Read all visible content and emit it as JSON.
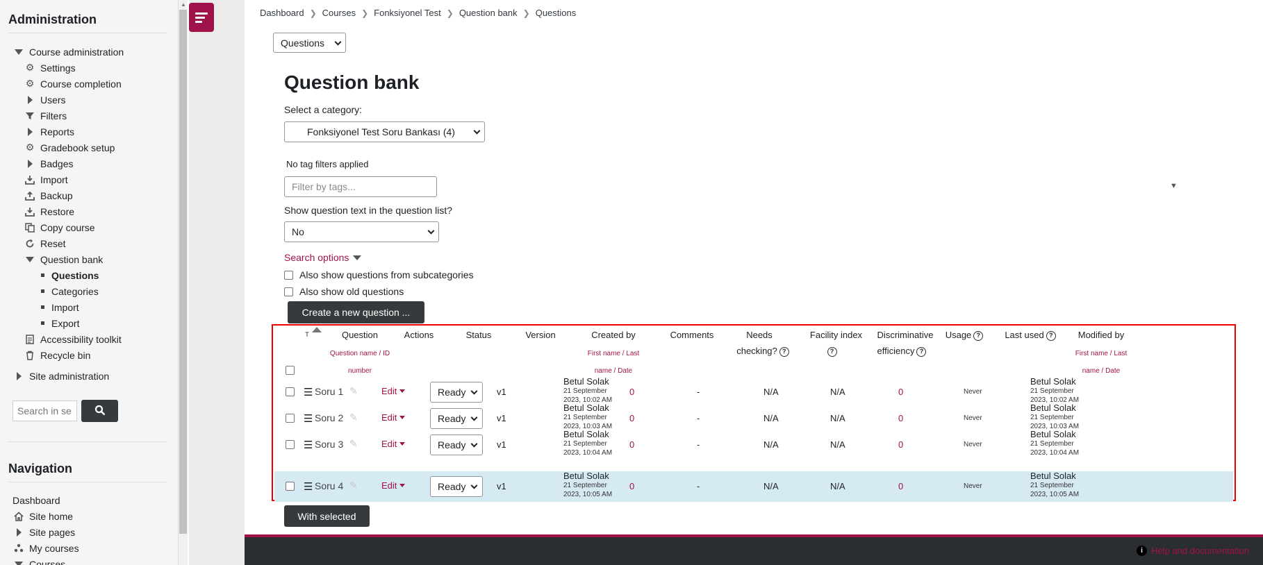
{
  "sidebar": {
    "admin_title": "Administration",
    "items": [
      {
        "label": "Course administration",
        "icon": "triangle-down"
      },
      {
        "label": "Settings",
        "icon": "gear-icon"
      },
      {
        "label": "Course completion",
        "icon": "gear-icon"
      },
      {
        "label": "Users",
        "icon": "triangle-right"
      },
      {
        "label": "Filters",
        "icon": "filter-icon"
      },
      {
        "label": "Reports",
        "icon": "triangle-right"
      },
      {
        "label": "Gradebook setup",
        "icon": "gear-icon"
      },
      {
        "label": "Badges",
        "icon": "triangle-right"
      },
      {
        "label": "Import",
        "icon": "import-icon"
      },
      {
        "label": "Backup",
        "icon": "backup-icon"
      },
      {
        "label": "Restore",
        "icon": "restore-icon"
      },
      {
        "label": "Copy course",
        "icon": "copy-icon"
      },
      {
        "label": "Reset",
        "icon": "reset-icon"
      },
      {
        "label": "Question bank",
        "icon": "triangle-down"
      },
      {
        "label": "Questions",
        "icon": "bullet"
      },
      {
        "label": "Categories",
        "icon": "bullet"
      },
      {
        "label": "Import",
        "icon": "bullet"
      },
      {
        "label": "Export",
        "icon": "bullet"
      },
      {
        "label": "Accessibility toolkit",
        "icon": "toolkit-icon"
      },
      {
        "label": "Recycle bin",
        "icon": "trash-icon"
      },
      {
        "label": "Site administration",
        "icon": "triangle-right"
      }
    ],
    "search_placeholder": "Search in se",
    "nav_title": "Navigation",
    "nav_items": [
      {
        "label": "Dashboard"
      },
      {
        "label": "Site home",
        "icon": "home-icon"
      },
      {
        "label": "Site pages",
        "icon": "triangle-right"
      },
      {
        "label": "My courses",
        "icon": "courses-icon"
      },
      {
        "label": "Courses",
        "icon": "triangle-down"
      }
    ]
  },
  "breadcrumb": [
    "Dashboard",
    "Courses",
    "Fonksiyonel Test",
    "Question bank",
    "Questions"
  ],
  "page_select": "Questions",
  "page_title": "Question bank",
  "category_label": "Select a category:",
  "category_value": "Fonksiyonel Test Soru Bankası (4)",
  "tag_status": "No tag filters applied",
  "tag_placeholder": "Filter by tags...",
  "show_text_label": "Show question text in the question list?",
  "show_text_value": "No",
  "search_options": "Search options",
  "opt_subcategories": "Also show questions from subcategories",
  "opt_old": "Also show old questions",
  "create_button": "Create a new question ...",
  "table": {
    "col_t": "T",
    "col_question": "Question",
    "col_question_sub": "Question name / ID",
    "col_question_sub2": "number",
    "col_actions": "Actions",
    "col_status": "Status",
    "col_version": "Version",
    "col_created": "Created by",
    "col_created_sub": "First name / Last",
    "col_created_sub2": "name / Date",
    "col_comments": "Comments",
    "col_needs": "Needs",
    "col_needs2": "checking?",
    "col_facility": "Facility index",
    "col_discrim": "Discriminative",
    "col_discrim2": "efficiency",
    "col_usage": "Usage",
    "col_lastused": "Last used",
    "col_modified": "Modified by",
    "col_modified_sub": "First name / Last",
    "col_modified_sub2": "name / Date",
    "rows": [
      {
        "name": "Soru 1",
        "edit": "Edit",
        "status": "Ready",
        "version": "v1",
        "creator": "Betul Solak",
        "created_date1": "21 September",
        "created_date2": "2023, 10:02 AM",
        "comments": "0",
        "needs": "-",
        "facility": "N/A",
        "discrim": "N/A",
        "usage": "0",
        "last_used": "Never",
        "modifier": "Betul Solak",
        "mod_date1": "21 September",
        "mod_date2": "2023, 10:02 AM"
      },
      {
        "name": "Soru 2",
        "edit": "Edit",
        "status": "Ready",
        "version": "v1",
        "creator": "Betul Solak",
        "created_date1": "21 September",
        "created_date2": "2023, 10:03 AM",
        "comments": "0",
        "needs": "-",
        "facility": "N/A",
        "discrim": "N/A",
        "usage": "0",
        "last_used": "Never",
        "modifier": "Betul Solak",
        "mod_date1": "21 September",
        "mod_date2": "2023, 10:03 AM"
      },
      {
        "name": "Soru 3",
        "edit": "Edit",
        "status": "Ready",
        "version": "v1",
        "creator": "Betul Solak",
        "created_date1": "21 September",
        "created_date2": "2023, 10:04 AM",
        "comments": "0",
        "needs": "-",
        "facility": "N/A",
        "discrim": "N/A",
        "usage": "0",
        "last_used": "Never",
        "modifier": "Betul Solak",
        "mod_date1": "21 September",
        "mod_date2": "2023, 10:04 AM"
      },
      {
        "name": "Soru 4",
        "edit": "Edit",
        "status": "Ready",
        "version": "v1",
        "creator": "Betul Solak",
        "created_date1": "21 September",
        "created_date2": "2023, 10:05 AM",
        "comments": "0",
        "needs": "-",
        "facility": "N/A",
        "discrim": "N/A",
        "usage": "0",
        "last_used": "Never",
        "modifier": "Betul Solak",
        "mod_date1": "21 September",
        "mod_date2": "2023, 10:05 AM"
      }
    ]
  },
  "with_selected": "With selected",
  "footer_help": "Help and documentation",
  "colors": {
    "brand": "#a0124a",
    "dark": "#373a3c",
    "highlight": "#d6eaf4",
    "annotation": "#ee0000"
  }
}
